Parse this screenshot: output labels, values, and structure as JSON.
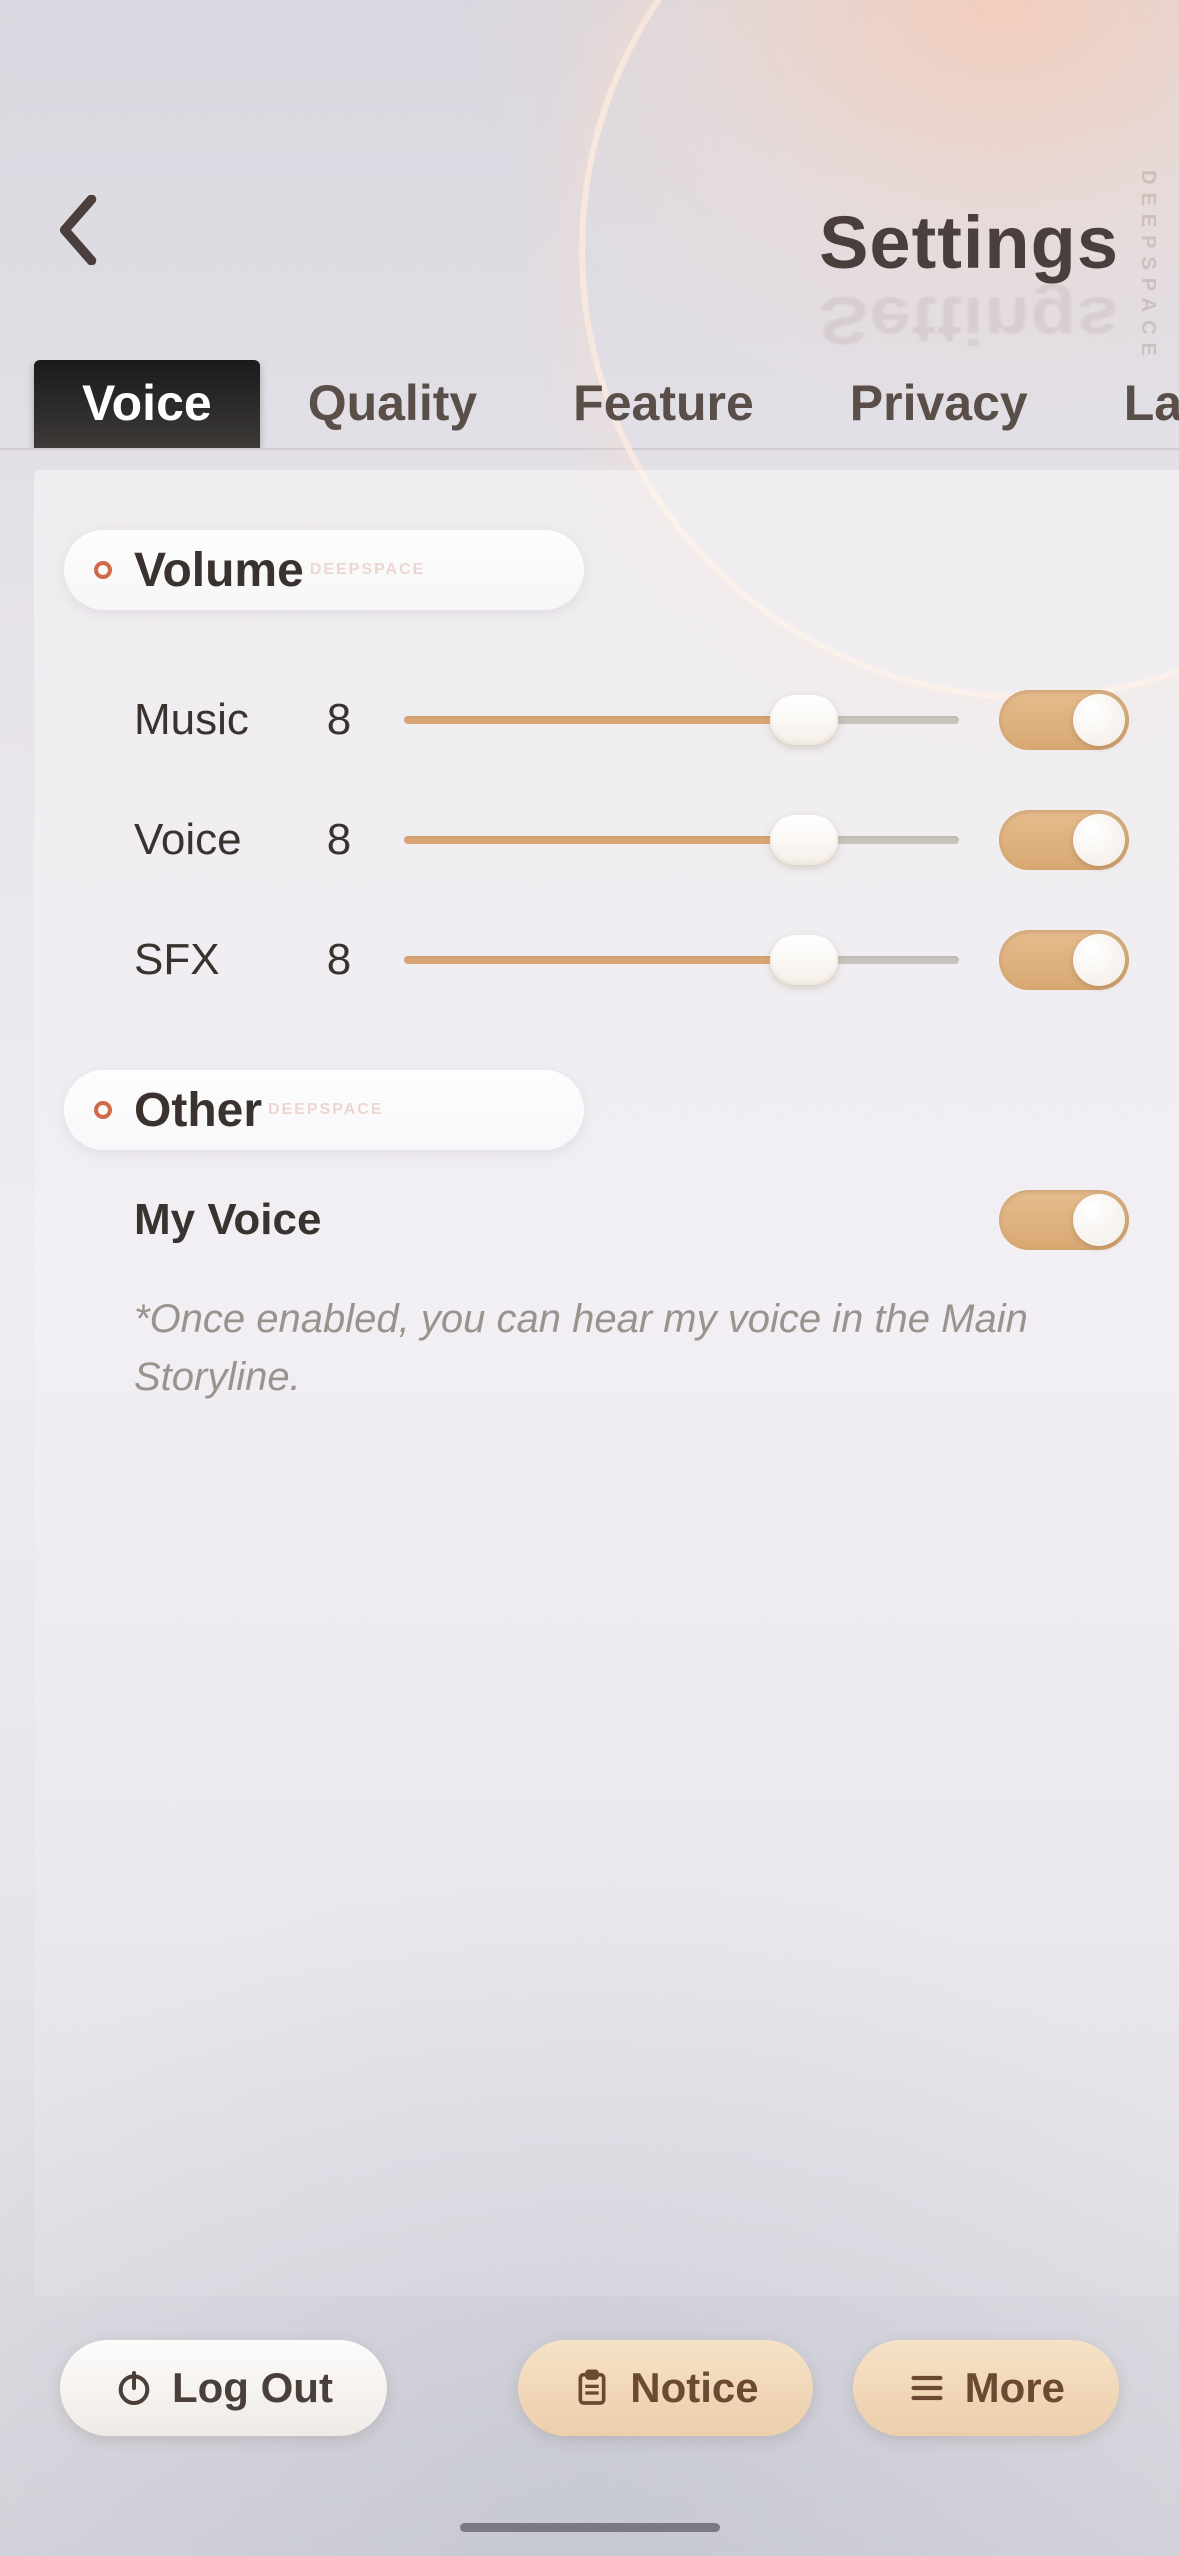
{
  "header": {
    "title": "Settings",
    "side_text": "DEEPSPACE"
  },
  "tabs": [
    {
      "label": "Voice",
      "active": true
    },
    {
      "label": "Quality",
      "active": false
    },
    {
      "label": "Feature",
      "active": false
    },
    {
      "label": "Privacy",
      "active": false
    },
    {
      "label": "Language",
      "active": false
    }
  ],
  "sections": {
    "volume": {
      "title": "Volume",
      "deco": "DEEPSPACE",
      "rows": [
        {
          "label": "Music",
          "value": 8,
          "max": 10,
          "on": true
        },
        {
          "label": "Voice",
          "value": 8,
          "max": 10,
          "on": true
        },
        {
          "label": "SFX",
          "value": 8,
          "max": 10,
          "on": true
        }
      ]
    },
    "other": {
      "title": "Other",
      "deco": "DEEPSPACE",
      "my_voice_label": "My Voice",
      "my_voice_on": true,
      "note": "*Once enabled, you can hear my voice in the Main Storyline."
    }
  },
  "footer": {
    "logout": "Log Out",
    "notice": "Notice",
    "more": "More"
  },
  "colors": {
    "accent_warm": "#d9a574",
    "tab_active_bg": "#2a2826",
    "text_dark": "#3a322e"
  }
}
